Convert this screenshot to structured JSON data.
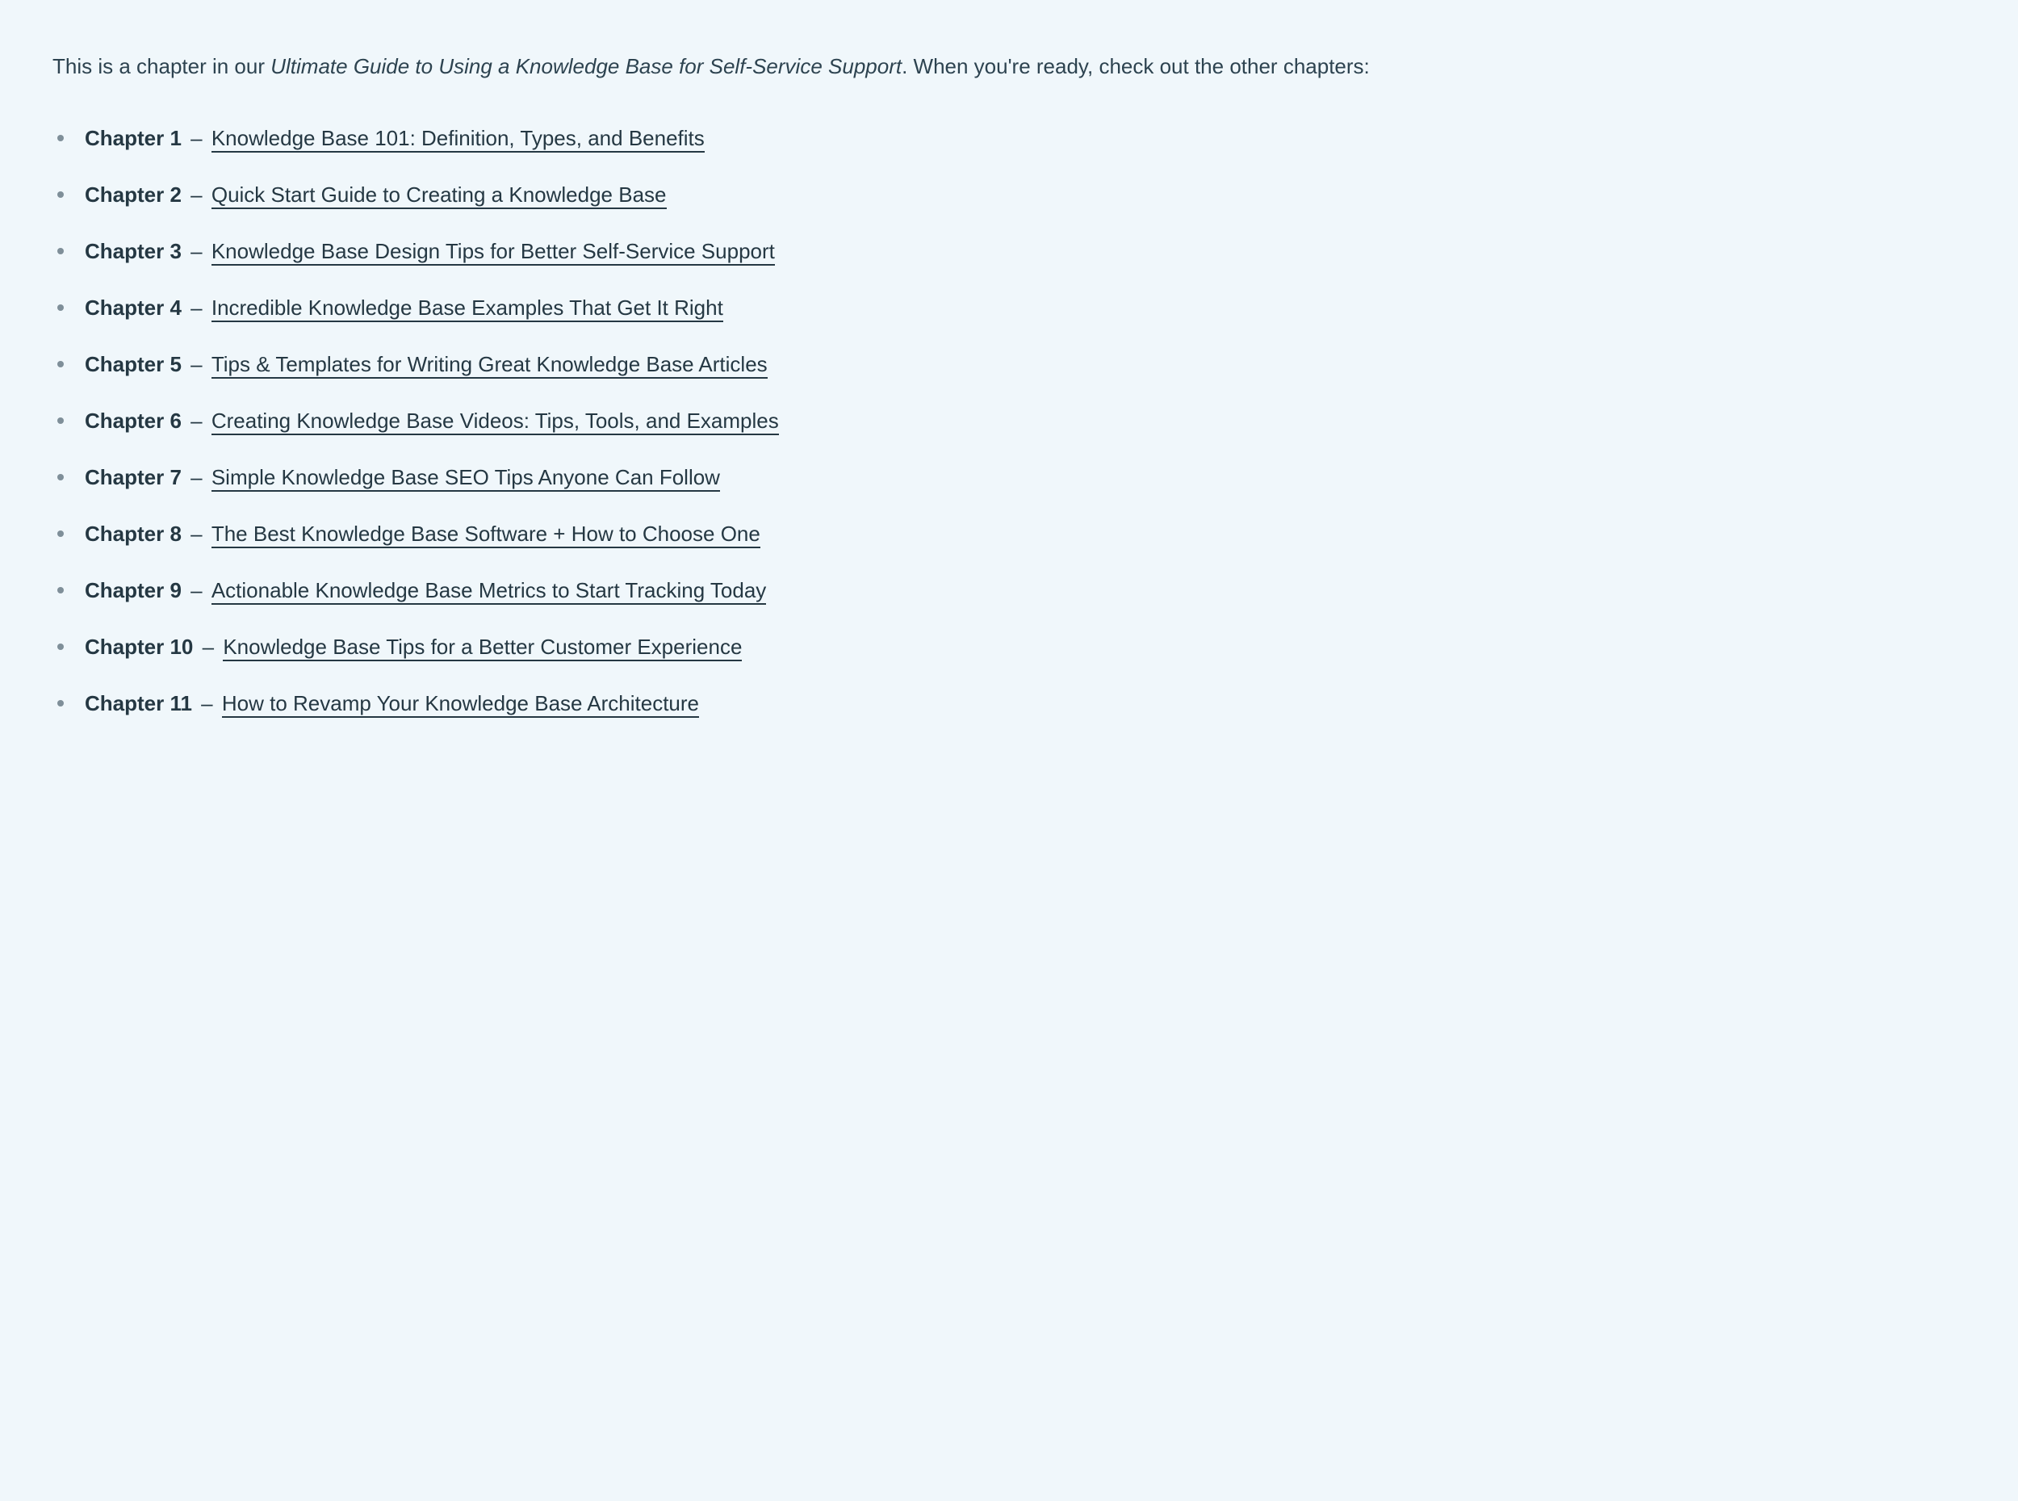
{
  "intro": {
    "prefix": "This is a chapter in our ",
    "guide_title": "Ultimate Guide to Using a Knowledge Base for Self-Service Support",
    "suffix": ". When you're ready, check out the other chapters:"
  },
  "separator": " – ",
  "chapters": [
    {
      "label": "Chapter 1",
      "title": "Knowledge Base 101: Definition, Types, and Benefits"
    },
    {
      "label": "Chapter 2",
      "title": "Quick Start Guide to Creating a Knowledge Base"
    },
    {
      "label": "Chapter 3",
      "title": "Knowledge Base Design Tips for Better Self-Service Support"
    },
    {
      "label": "Chapter 4",
      "title": "Incredible Knowledge Base Examples That Get It Right"
    },
    {
      "label": "Chapter 5",
      "title": "Tips & Templates for Writing Great Knowledge Base Articles"
    },
    {
      "label": "Chapter 6",
      "title": "Creating Knowledge Base Videos: Tips, Tools, and Examples"
    },
    {
      "label": "Chapter 7",
      "title": "Simple Knowledge Base SEO Tips Anyone Can Follow"
    },
    {
      "label": "Chapter 8",
      "title": "The Best Knowledge Base Software + How to Choose One"
    },
    {
      "label": "Chapter 9",
      "title": "Actionable Knowledge Base Metrics to Start Tracking Today"
    },
    {
      "label": "Chapter 10",
      "title": "Knowledge Base Tips for a Better Customer Experience"
    },
    {
      "label": "Chapter 11",
      "title": "How to Revamp Your Knowledge Base Architecture"
    }
  ]
}
